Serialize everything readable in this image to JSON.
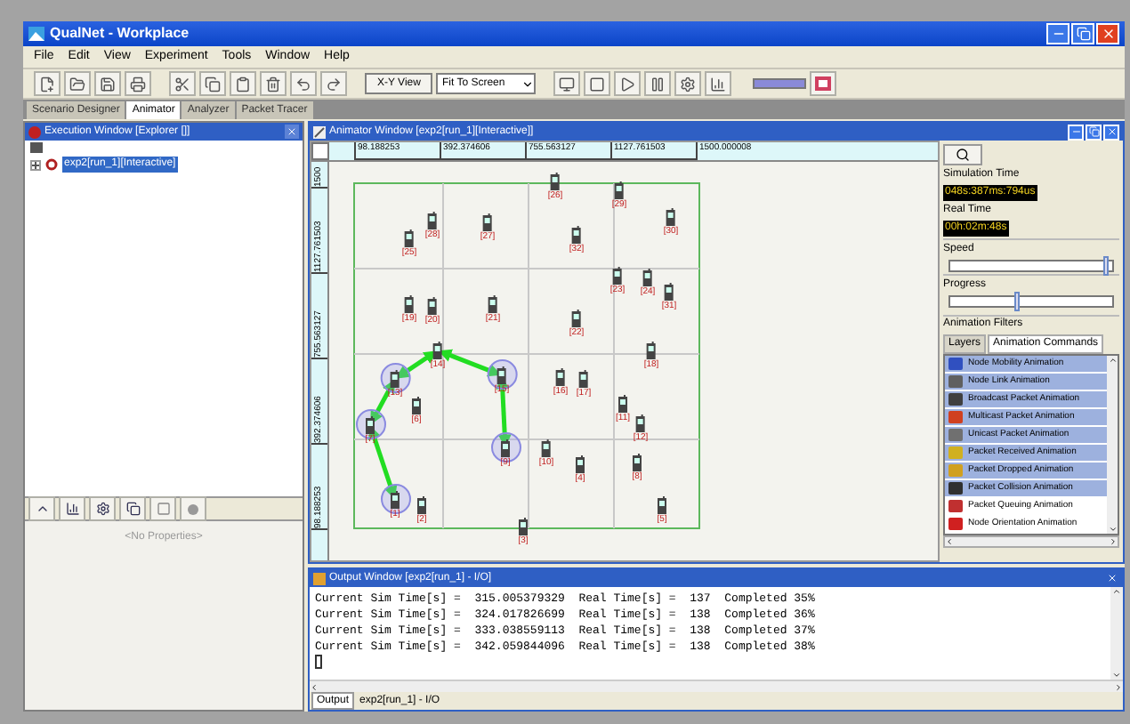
{
  "window": {
    "title": "QualNet - Workplace"
  },
  "menu": [
    "File",
    "Edit",
    "View",
    "Experiment",
    "Tools",
    "Window",
    "Help"
  ],
  "toolbar": {
    "view_button": "X-Y View",
    "zoom_select": "Fit To Screen"
  },
  "tabs": [
    {
      "label": "Scenario Designer",
      "selected": false
    },
    {
      "label": "Animator",
      "selected": true
    },
    {
      "label": "Analyzer",
      "selected": false
    },
    {
      "label": "Packet Tracer",
      "selected": false
    }
  ],
  "explorer": {
    "title": "Execution Window [Explorer []]",
    "tree": [
      {
        "label": "exp2[run_1][Interactive]",
        "selected": true,
        "expanded": false
      }
    ]
  },
  "properties": {
    "empty_text": "<No Properties>"
  },
  "animator": {
    "title": "Animator Window [exp2[run_1][Interactive]]",
    "x_ruler": [
      "98.188253",
      "392.374606",
      "755.563127",
      "1127.761503",
      "1500.000008"
    ],
    "y_ruler": [
      "1500",
      "1127.761503",
      "755.563127",
      "392.374606",
      "98.188253"
    ],
    "nodes": [
      {
        "label": "[26]",
        "highlighted": false
      },
      {
        "label": "[29]",
        "highlighted": false
      },
      {
        "label": "[28]",
        "highlighted": false
      },
      {
        "label": "[27]",
        "highlighted": false
      },
      {
        "label": "[30]",
        "highlighted": false
      },
      {
        "label": "[25]",
        "highlighted": false
      },
      {
        "label": "[32]",
        "highlighted": false
      },
      {
        "label": "[23]",
        "highlighted": false
      },
      {
        "label": "[24]",
        "highlighted": false
      },
      {
        "label": "[31]",
        "highlighted": false
      },
      {
        "label": "[19]",
        "highlighted": false
      },
      {
        "label": "[20]",
        "highlighted": false
      },
      {
        "label": "[21]",
        "highlighted": false
      },
      {
        "label": "[22]",
        "highlighted": false
      },
      {
        "label": "[18]",
        "highlighted": false
      },
      {
        "label": "[14]",
        "highlighted": false
      },
      {
        "label": "[13]",
        "highlighted": true
      },
      {
        "label": "[15]",
        "highlighted": true
      },
      {
        "label": "[16]",
        "highlighted": false
      },
      {
        "label": "[17]",
        "highlighted": false
      },
      {
        "label": "[6]",
        "highlighted": false
      },
      {
        "label": "[11]",
        "highlighted": false
      },
      {
        "label": "[12]",
        "highlighted": false
      },
      {
        "label": "[7]",
        "highlighted": true
      },
      {
        "label": "[9]",
        "highlighted": true
      },
      {
        "label": "[10]",
        "highlighted": false
      },
      {
        "label": "[4]",
        "highlighted": false
      },
      {
        "label": "[8]",
        "highlighted": false
      },
      {
        "label": "[1]",
        "highlighted": true
      },
      {
        "label": "[2]",
        "highlighted": false
      },
      {
        "label": "[5]",
        "highlighted": false
      },
      {
        "label": "[3]",
        "highlighted": false
      }
    ],
    "simulation_time_label": "Simulation Time",
    "simulation_time": "048s:387ms:794us",
    "real_time_label": "Real Time",
    "real_time": "00h:02m:48s",
    "speed": {
      "label": "Speed",
      "level": 0.97
    },
    "progress": {
      "label": "Progress",
      "level": 0.42
    },
    "filters": {
      "title": "Animation Filters",
      "tabs": [
        {
          "label": "Layers",
          "selected": false
        },
        {
          "label": "Animation Commands",
          "selected": true
        }
      ],
      "items": [
        {
          "label": "Node Mobility Animation",
          "selected": true
        },
        {
          "label": "Node Link Animation",
          "selected": true
        },
        {
          "label": "Broadcast Packet Animation",
          "selected": true
        },
        {
          "label": "Multicast Packet Animation",
          "selected": true
        },
        {
          "label": "Unicast Packet Animation",
          "selected": true
        },
        {
          "label": "Packet Received Animation",
          "selected": true
        },
        {
          "label": "Packet Dropped Animation",
          "selected": true
        },
        {
          "label": "Packet Collision Animation",
          "selected": true
        },
        {
          "label": "Packet Queuing Animation",
          "selected": false
        },
        {
          "label": "Node Orientation Animation",
          "selected": false
        }
      ]
    }
  },
  "output": {
    "title": "Output Window [exp2[run_1] - I/O]",
    "lines": [
      "Current Sim Time[s] =  315.005379329  Real Time[s] =  137  Completed 35%",
      "Current Sim Time[s] =  324.017826699  Real Time[s] =  138  Completed 36%",
      "Current Sim Time[s] =  333.038559113  Real Time[s] =  138  Completed 37%",
      "Current Sim Time[s] =  342.059844096  Real Time[s] =  138  Completed 38%"
    ],
    "tabs": [
      {
        "label": "Output",
        "selected": true
      },
      {
        "label": "exp2[run_1] - I/O",
        "selected": false
      }
    ]
  }
}
